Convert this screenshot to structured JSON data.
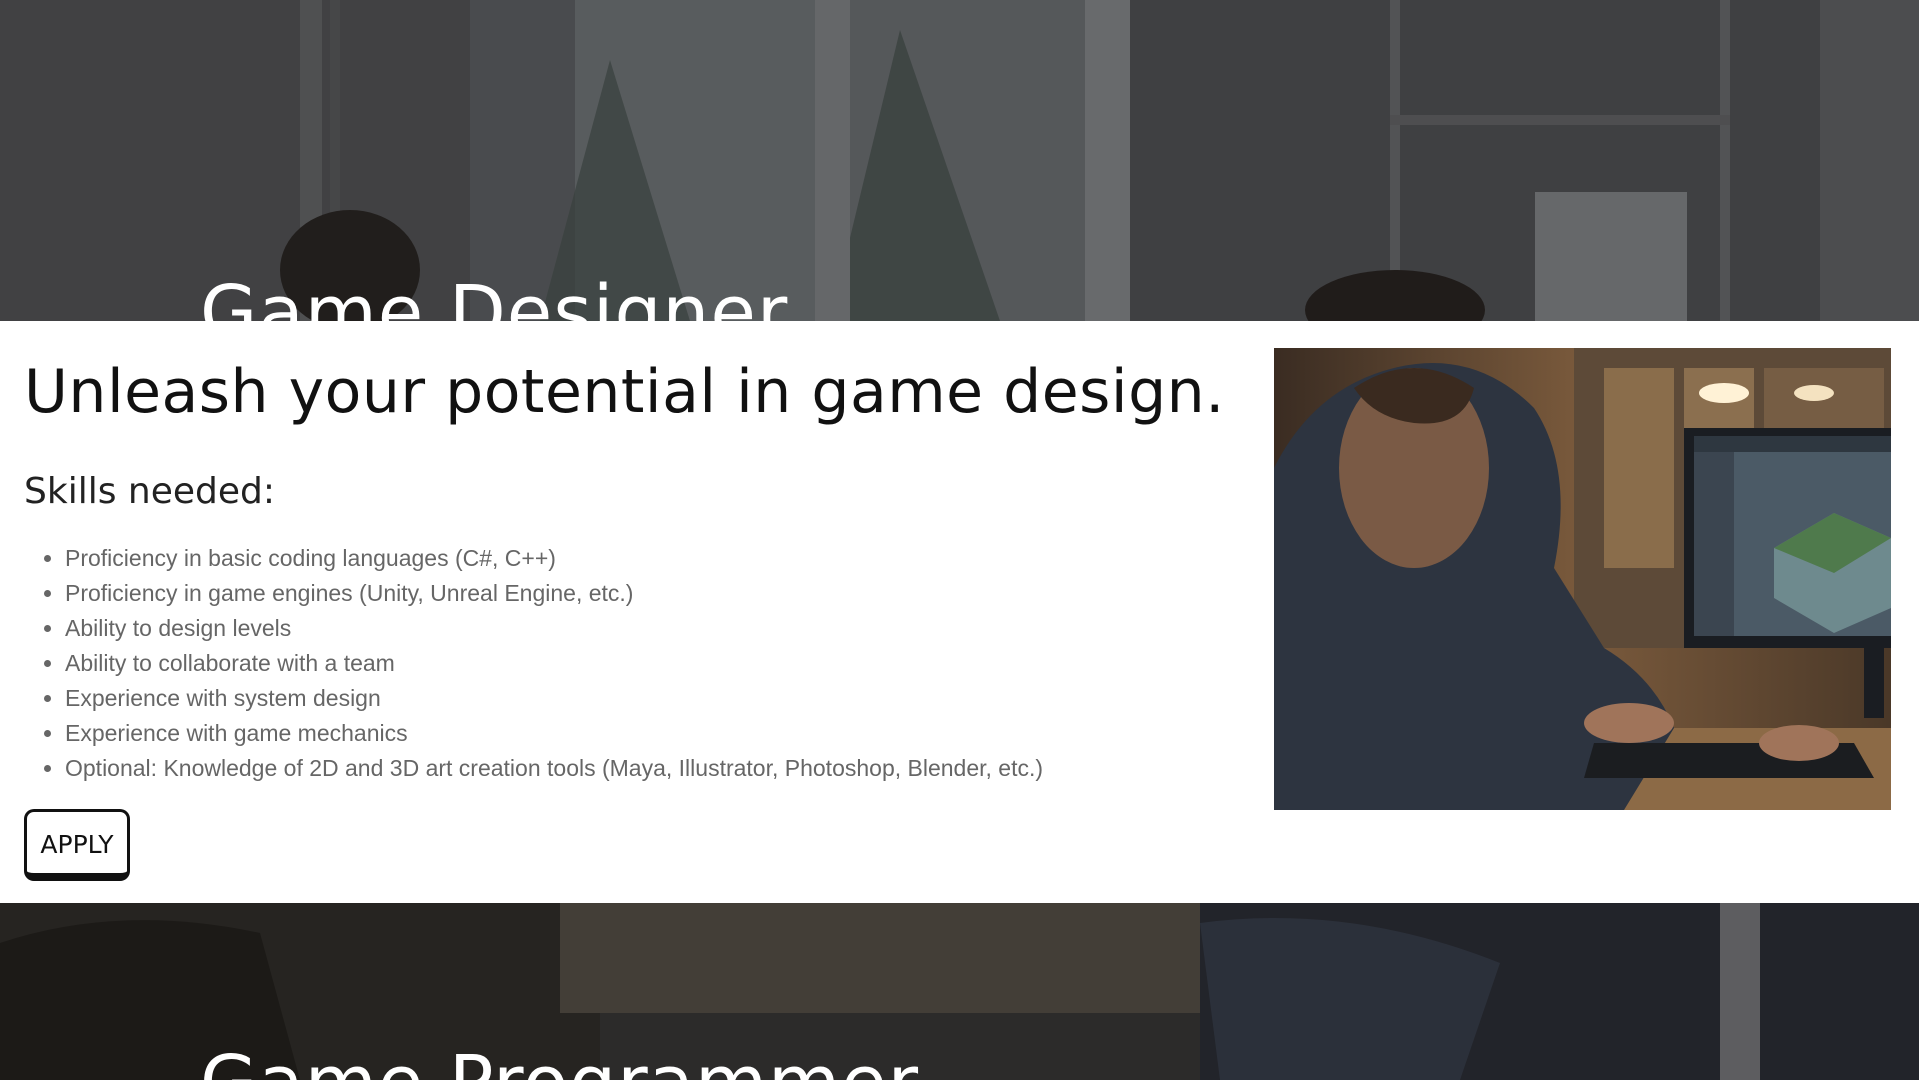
{
  "sections": {
    "designer": {
      "title": "Game Designer",
      "headline": "Unleash your potential in game design.",
      "skills_heading": "Skills needed:",
      "skills": [
        "Proficiency in basic coding languages (C#, C++)",
        "Proficiency in game engines (Unity, Unreal Engine, etc.)",
        "Ability to design levels",
        "Ability to collaborate with a team",
        "Experience with system design",
        "Experience with game mechanics",
        "Optional: Knowledge of 2D and 3D art creation tools (Maya, Illustrator, Photoshop, Blender, etc.)"
      ],
      "apply_label": "APPLY"
    },
    "programmer": {
      "title": "Game Programmer"
    }
  },
  "colors": {
    "banner_overlay": "#3a3b3e",
    "headline_text": "#111111",
    "list_text": "#666666",
    "button_border": "#111111"
  }
}
